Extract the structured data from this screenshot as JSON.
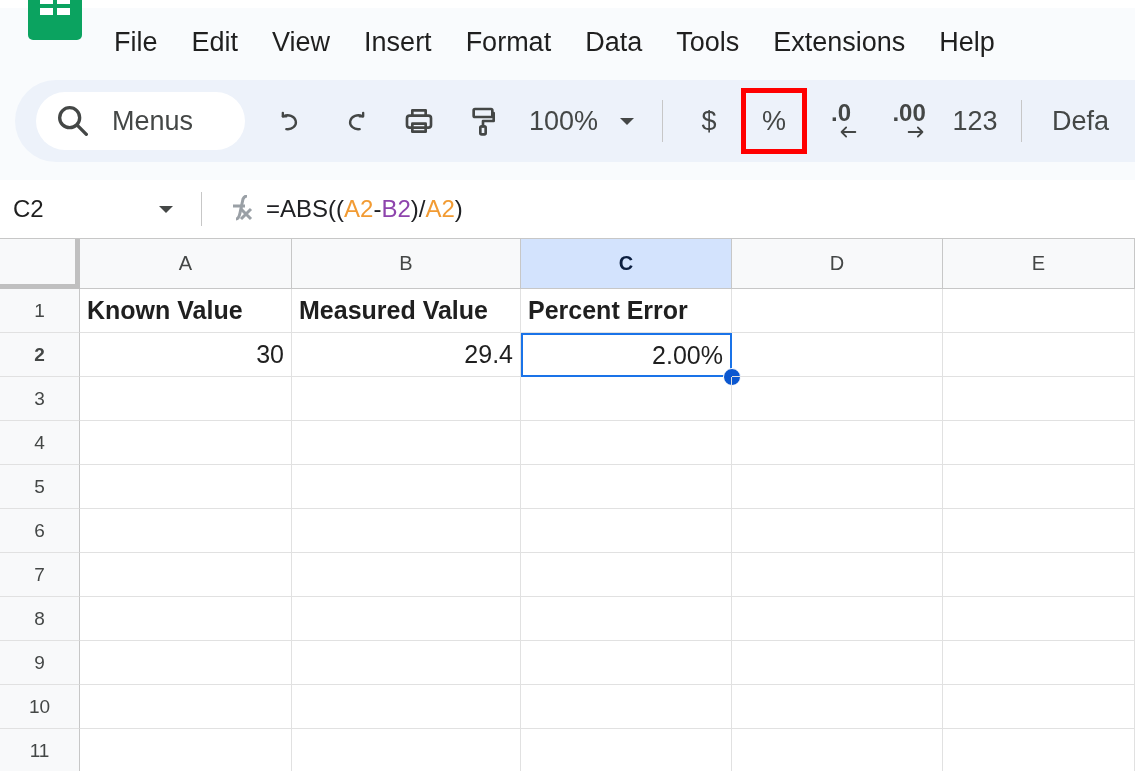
{
  "menu_bar": {
    "items": [
      "File",
      "Edit",
      "View",
      "Insert",
      "Format",
      "Data",
      "Tools",
      "Extensions",
      "Help"
    ]
  },
  "toolbar": {
    "search": {
      "placeholder": "Menus"
    },
    "items": [
      {
        "kind": "undo"
      },
      {
        "kind": "redo"
      },
      {
        "kind": "print"
      },
      {
        "kind": "paint-format"
      },
      {
        "kind": "zoom",
        "label": "100%"
      },
      {
        "kind": "separator"
      },
      {
        "kind": "text",
        "label": "$",
        "highlighted": false
      },
      {
        "kind": "text",
        "label": "%",
        "highlighted": true
      },
      {
        "kind": "decimal-decrease",
        "label": ".0"
      },
      {
        "kind": "decimal-increase",
        "label": ".00"
      },
      {
        "kind": "text",
        "label": "123",
        "highlighted": false
      },
      {
        "kind": "separator"
      },
      {
        "kind": "font",
        "label": "Defa"
      }
    ]
  },
  "formula_bar": {
    "name_box": "C2",
    "formula": [
      {
        "text": "=ABS((",
        "color": "#202124"
      },
      {
        "text": "A2",
        "color": "#f29b33"
      },
      {
        "text": "-",
        "color": "#202124"
      },
      {
        "text": "B2",
        "color": "#8e44ad"
      },
      {
        "text": ")/",
        "color": "#202124"
      },
      {
        "text": "A2",
        "color": "#f29b33"
      },
      {
        "text": ")",
        "color": "#202124"
      }
    ]
  },
  "sheet": {
    "columns": [
      {
        "label": "A",
        "selected": false
      },
      {
        "label": "B",
        "selected": false
      },
      {
        "label": "C",
        "selected": true
      },
      {
        "label": "D",
        "selected": false
      },
      {
        "label": "E",
        "selected": false
      }
    ],
    "rows": [
      {
        "label": "1",
        "selected": false,
        "cells": [
          {
            "text": "Known Value",
            "kind": "heading",
            "selected": false
          },
          {
            "text": "Measured Value",
            "kind": "heading",
            "selected": false
          },
          {
            "text": "Percent Error",
            "kind": "heading",
            "selected": false
          }
        ]
      },
      {
        "label": "2",
        "selected": true,
        "cells": [
          {
            "text": "30",
            "kind": "number",
            "selected": false
          },
          {
            "text": "29.4",
            "kind": "number",
            "selected": false
          },
          {
            "text": "2.00%",
            "kind": "number",
            "selected": true
          }
        ]
      },
      {
        "label": "3",
        "selected": false
      },
      {
        "label": "4",
        "selected": false
      },
      {
        "label": "5",
        "selected": false
      },
      {
        "label": "6",
        "selected": false
      },
      {
        "label": "7",
        "selected": false
      },
      {
        "label": "8",
        "selected": false
      },
      {
        "label": "9",
        "selected": false
      },
      {
        "label": "10",
        "selected": false
      },
      {
        "label": "11",
        "selected": false
      }
    ]
  }
}
